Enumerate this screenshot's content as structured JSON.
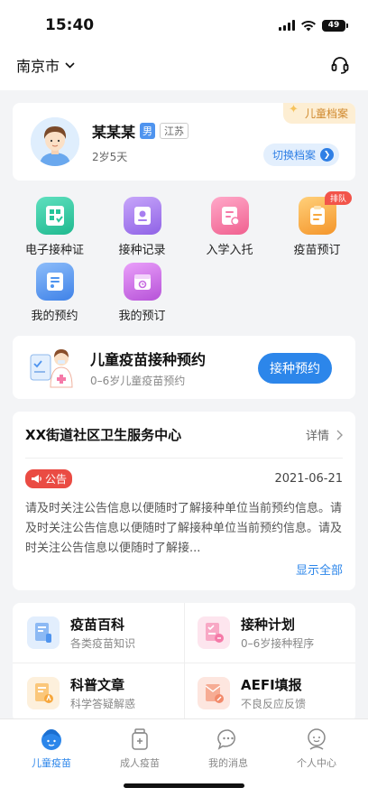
{
  "status_bar": {
    "time": "15:40",
    "battery": "49"
  },
  "header": {
    "city": "南京市"
  },
  "profile": {
    "name": "某某某",
    "gender": "男",
    "region": "江苏",
    "age": "2岁5天",
    "archive_label": "儿童档案",
    "switch_label": "切换档案"
  },
  "menu": [
    {
      "label": "电子接种证",
      "icon": "certificate-icon",
      "color": "#26c59a"
    },
    {
      "label": "接种记录",
      "icon": "record-icon",
      "color": "#a77ef0"
    },
    {
      "label": "入学入托",
      "icon": "enrollment-icon",
      "color": "#f57aa8"
    },
    {
      "label": "疫苗预订",
      "icon": "clipboard-icon",
      "color": "#f7a73c",
      "badge": "排队"
    },
    {
      "label": "我的预约",
      "icon": "appointment-list-icon",
      "color": "#4f94ef"
    },
    {
      "label": "我的预订",
      "icon": "calendar-icon",
      "color": "#c76be0"
    }
  ],
  "appointment": {
    "title": "儿童疫苗接种预约",
    "subtitle": "0–6岁儿童疫苗预约",
    "button": "接种预约"
  },
  "center": {
    "name": "XX街道社区卫生服务中心",
    "details": "详情",
    "notice_tag": "公告",
    "date": "2021-06-21",
    "notice_text": "请及时关注公告信息以便随时了解接种单位当前预约信息。请及时关注公告信息以便随时了解接种单位当前预约信息。请及时关注公告信息以便随时了解接...",
    "show_all": "显示全部"
  },
  "quick_links": [
    {
      "title": "疫苗百科",
      "subtitle": "各类疫苗知识",
      "icon": "vaccine-book-icon",
      "color": "#4f94ef"
    },
    {
      "title": "接种计划",
      "subtitle": "0–6岁接种程序",
      "icon": "plan-icon",
      "color": "#f57aa8"
    },
    {
      "title": "科普文章",
      "subtitle": "科学答疑解惑",
      "icon": "article-icon",
      "color": "#f7a73c"
    },
    {
      "title": "AEFI填报",
      "subtitle": "不良反应反馈",
      "icon": "aefi-report-icon",
      "color": "#f28a6b"
    }
  ],
  "tabs": [
    {
      "label": "儿童疫苗",
      "active": true
    },
    {
      "label": "成人疫苗",
      "active": false
    },
    {
      "label": "我的消息",
      "active": false
    },
    {
      "label": "个人中心",
      "active": false
    }
  ],
  "colors": {
    "primary": "#2c86ea",
    "alert": "#ea4b43",
    "archive": "#d0882c"
  }
}
